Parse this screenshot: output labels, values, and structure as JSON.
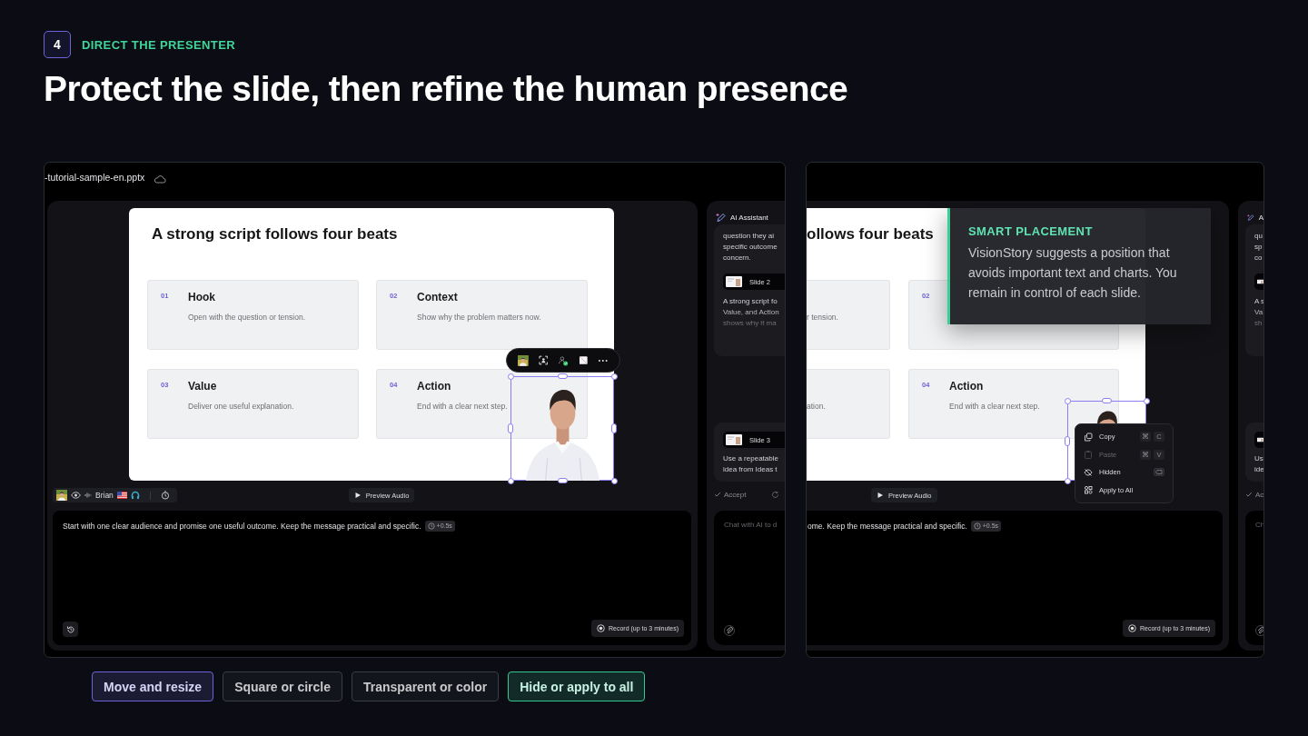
{
  "header": {
    "step": "4",
    "eyebrow": "DIRECT THE PRESENTER",
    "title": "Protect the slide, then refine the human presence"
  },
  "left_screen": {
    "file_name": "-tutorial-sample-en.pptx",
    "slide": {
      "title": "A strong script follows four beats",
      "cards": [
        {
          "number": "01",
          "title": "Hook",
          "text": "Open with the question or tension."
        },
        {
          "number": "02",
          "title": "Context",
          "text": "Show why the problem matters now."
        },
        {
          "number": "03",
          "title": "Value",
          "text": "Deliver one useful explanation."
        },
        {
          "number": "04",
          "title": "Action",
          "text": "End with a clear next step."
        }
      ]
    },
    "presenter": {
      "name": "Brian"
    },
    "preview_button": "Preview Audio",
    "script": {
      "text": "Start with one clear audience and promise one useful outcome. Keep the message practical and specific.",
      "delay": "+0.5s"
    },
    "record_button": "Record (up to 3 minutes)",
    "ai_panel": {
      "title": "AI Assistant",
      "cards": [
        {
          "before": [
            "question they ai",
            "specific outcome",
            "concern."
          ],
          "slide_label": "Slide 2",
          "after": [
            "A strong script fo",
            "Value, and Action",
            "shows why it ma"
          ]
        },
        {
          "slide_label": "Slide 3",
          "after": [
            "Use a repeatable",
            "idea from Ideas t"
          ]
        }
      ],
      "accept": "Accept",
      "chat_placeholder": "Chat with AI to d"
    }
  },
  "right_screen": {
    "slide": {
      "title": "ollows four beats",
      "cards": [
        {
          "text": "r tension."
        },
        {
          "number": "02"
        },
        {
          "text": "ation."
        },
        {
          "number": "04",
          "title": "Action",
          "text": "End with a clear next step."
        }
      ]
    },
    "tooltip": {
      "title": "SMART PLACEMENT",
      "text": "VisionStory suggests a position that avoids important text and charts. You remain in control of each slide."
    },
    "context_menu": [
      {
        "kind": "shortcut",
        "label": "Copy",
        "keys": [
          "⌘",
          "C"
        ],
        "disabled": false
      },
      {
        "kind": "shortcut",
        "label": "Paste",
        "keys": [
          "⌘",
          "V"
        ],
        "disabled": true
      },
      {
        "kind": "key_icon",
        "label": "Hidden",
        "disabled": false
      },
      {
        "kind": "plain",
        "label": "Apply to All",
        "disabled": false
      }
    ],
    "preview_button": "Preview Audio",
    "script": {
      "text": "ome. Keep the message practical and specific.",
      "delay": "+0.5s"
    },
    "record_button": "Record (up to 3 minutes)",
    "ai_panel": {
      "title": "A",
      "cards": [
        {
          "before": [
            "qu",
            "sp",
            "co"
          ],
          "after": [
            "A s",
            "Va",
            "sh"
          ]
        },
        {
          "after": [
            "Us",
            "ide"
          ]
        }
      ],
      "accept": "Ac",
      "chat_placeholder": "Ch"
    }
  },
  "feature_chips": [
    {
      "label": "Move and resize",
      "color": "#6e63d9"
    },
    {
      "label": "Square or circle",
      "color": "#3a3c46"
    },
    {
      "label": "Transparent or color",
      "color": "#3a3c46"
    },
    {
      "label": "Hide or apply to all",
      "color": "#34c993"
    }
  ]
}
